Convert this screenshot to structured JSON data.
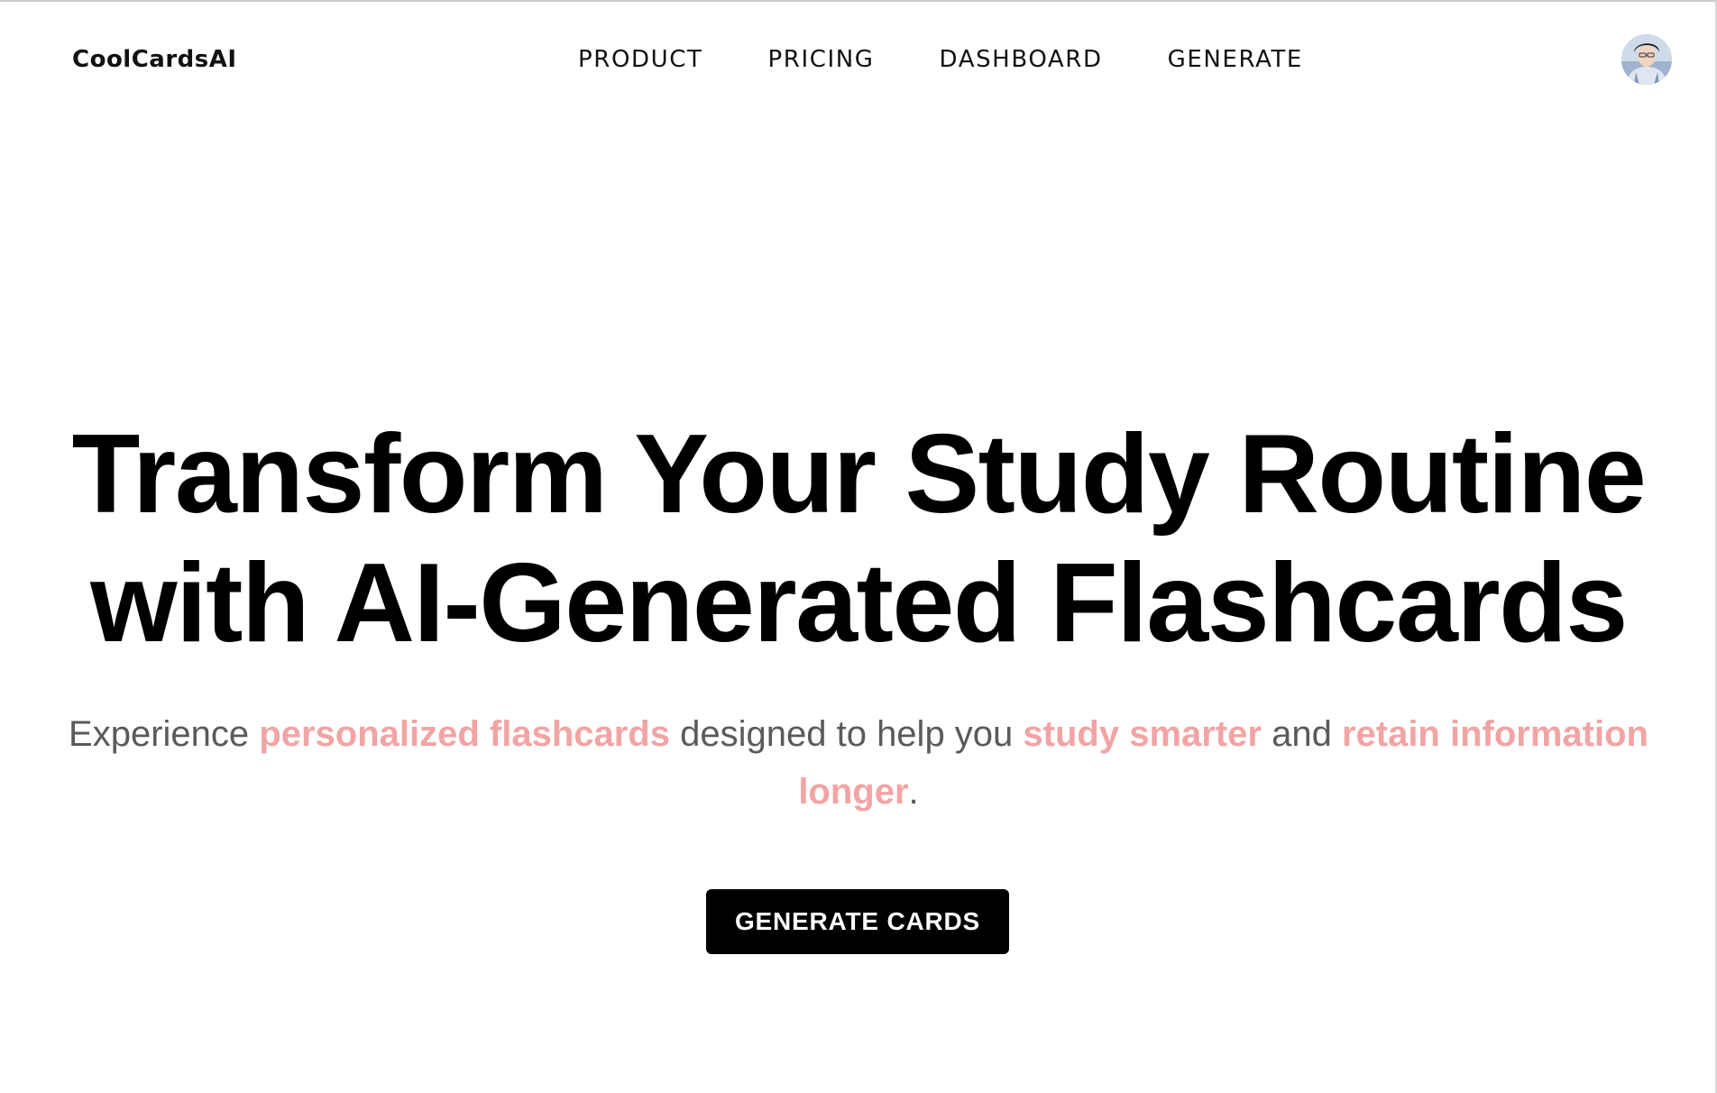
{
  "header": {
    "brand": "CoolCardsAI",
    "nav": {
      "product": "PRODUCT",
      "pricing": "PRICING",
      "dashboard": "DASHBOARD",
      "generate": "GENERATE"
    },
    "avatar_icon": "user-avatar-photo"
  },
  "hero": {
    "title_line1": "Transform Your Study Routine",
    "title_line2": "with AI-Generated Flashcards",
    "subtitle": {
      "part1": "Experience ",
      "highlight1": "personalized flashcards",
      "part2": " designed to help you ",
      "highlight2": "study smarter",
      "part3": " and ",
      "highlight3": "retain information longer",
      "part4": "."
    },
    "cta_label": "GENERATE CARDS"
  },
  "colors": {
    "highlight": "#f2a4a4",
    "subtitle_text": "#5a5a5a",
    "cta_background": "#000000",
    "cta_text": "#ffffff"
  }
}
